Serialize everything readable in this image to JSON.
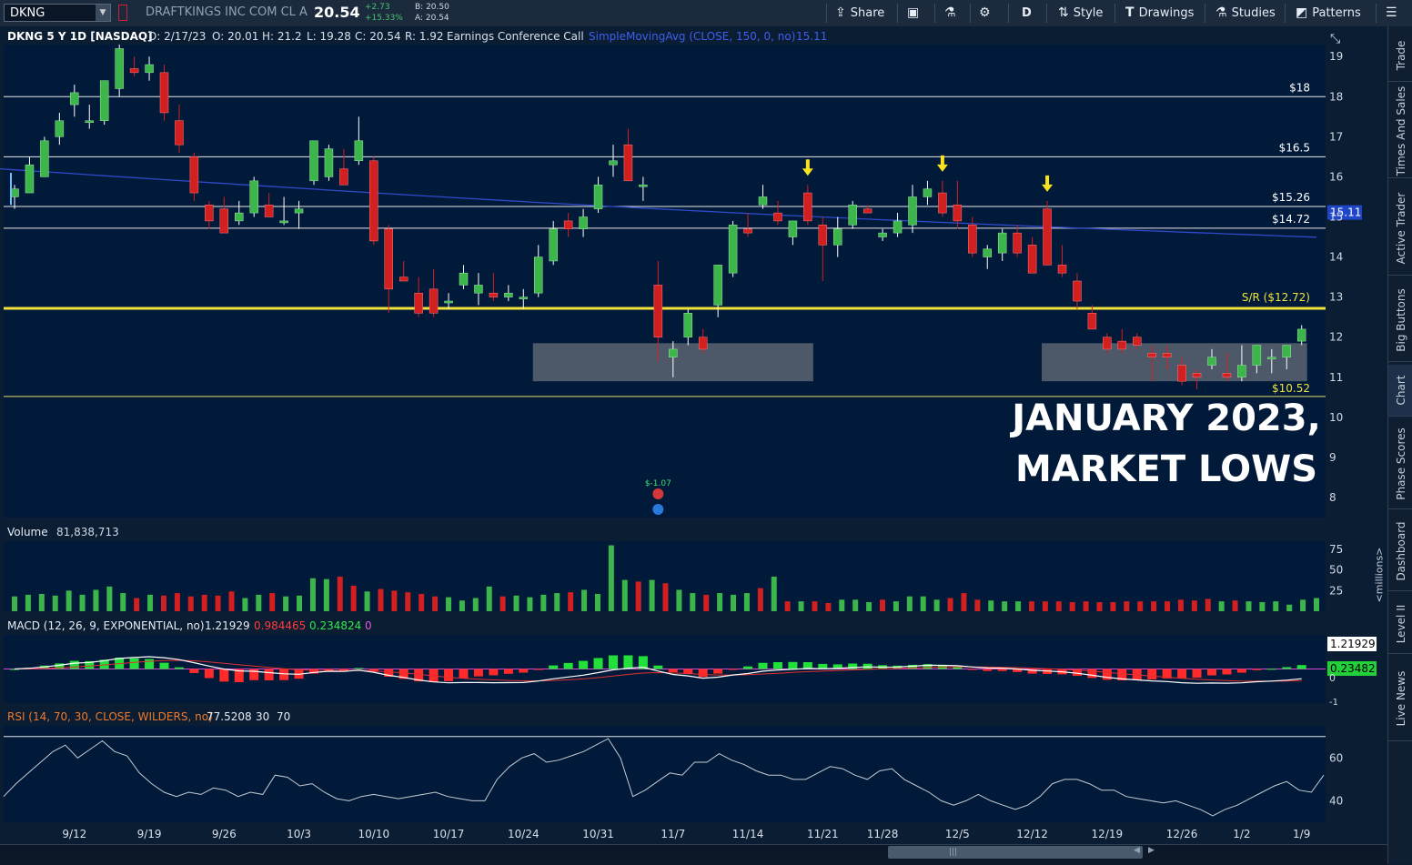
{
  "toolbar": {
    "symbol": "DKNG",
    "company": "DRAFTKINGS INC COM CL A",
    "last": "20.54",
    "change": "+2.73",
    "change_pct": "+15.33%",
    "bid": "B: 20.50",
    "ask": "A: 20.54",
    "share": "Share",
    "aggregation": "D",
    "style": "Style",
    "drawings": "Drawings",
    "studies": "Studies",
    "patterns": "Patterns"
  },
  "side_tabs": [
    "Trade",
    "Times And Sales",
    "Active Trader",
    "Big Buttons",
    "Chart",
    "Phase Scores",
    "Dashboard",
    "Level II",
    "Live News"
  ],
  "millions_label": "<millions>",
  "colors": {
    "up": "#3cb64a",
    "down": "#d21f1f",
    "sma": "#3049c9",
    "sr": "#f2e23a",
    "level": "#e8e8e8",
    "zone": "#5b6571",
    "bg": "#011a3a"
  },
  "chart_data": {
    "type": "candlestick",
    "header": {
      "title": "DKNG 5 Y 1D [NASDAQ]",
      "date": "D: 2/17/23",
      "open": "O: 20.01",
      "high": "H: 21.2",
      "low": "L: 19.28",
      "close": "C: 20.54",
      "range": "R: 1.92",
      "event": "Earnings Conference Call",
      "study": "SimpleMovingAvg (CLOSE, 150, 0, no)",
      "study_value": "15.11"
    },
    "annotation": [
      "JANUARY 2023,",
      "MARKET LOWS"
    ],
    "earnings": {
      "label": "$-1.07",
      "x_index": 43
    },
    "sma_label": "15.11",
    "ylim": [
      7.5,
      19.3
    ],
    "y_ticks": [
      8,
      9,
      10,
      11,
      12,
      13,
      14,
      15,
      16,
      17,
      18,
      19
    ],
    "x_ticks": [
      {
        "label": "9/12",
        "i": 4
      },
      {
        "label": "9/19",
        "i": 9
      },
      {
        "label": "9/26",
        "i": 14
      },
      {
        "label": "10/3",
        "i": 19
      },
      {
        "label": "10/10",
        "i": 24
      },
      {
        "label": "10/17",
        "i": 29
      },
      {
        "label": "10/24",
        "i": 34
      },
      {
        "label": "10/31",
        "i": 39
      },
      {
        "label": "11/7",
        "i": 44
      },
      {
        "label": "11/14",
        "i": 49
      },
      {
        "label": "11/21",
        "i": 54
      },
      {
        "label": "11/28",
        "i": 58
      },
      {
        "label": "12/5",
        "i": 63
      },
      {
        "label": "12/12",
        "i": 68
      },
      {
        "label": "12/19",
        "i": 73
      },
      {
        "label": "12/26",
        "i": 78
      },
      {
        "label": "1/2",
        "i": 82
      },
      {
        "label": "1/9",
        "i": 86
      }
    ],
    "levels": [
      {
        "label": "$18",
        "value": 18
      },
      {
        "label": "$16.5",
        "value": 16.5
      },
      {
        "label": "$15.26",
        "value": 15.26
      },
      {
        "label": "$14.72",
        "value": 14.72
      },
      {
        "label": "$10.52",
        "value": 10.52
      }
    ],
    "support_resistance": {
      "label": "S/R ($12.72)",
      "value": 12.72
    },
    "zones": [
      {
        "i_start": 35,
        "i_end": 53,
        "low": 10.9,
        "high": 11.85
      },
      {
        "i_start": 69,
        "i_end": 86,
        "low": 10.9,
        "high": 11.85
      }
    ],
    "arrows": [
      53,
      62,
      69
    ],
    "ohlc": [
      [
        15.5,
        15.8,
        15.2,
        15.7
      ],
      [
        15.6,
        16.5,
        15.6,
        16.3
      ],
      [
        16.0,
        17.0,
        16.0,
        16.9
      ],
      [
        17.0,
        17.6,
        16.8,
        17.4
      ],
      [
        17.8,
        18.3,
        17.5,
        18.1
      ],
      [
        17.4,
        17.8,
        17.2,
        17.4
      ],
      [
        17.4,
        18.4,
        17.3,
        18.4
      ],
      [
        18.2,
        19.3,
        18.0,
        19.2
      ],
      [
        18.7,
        19.0,
        18.5,
        18.6
      ],
      [
        18.6,
        19.0,
        18.4,
        18.8
      ],
      [
        18.6,
        18.8,
        17.4,
        17.6
      ],
      [
        17.4,
        17.8,
        16.6,
        16.8
      ],
      [
        16.5,
        16.6,
        15.4,
        15.6
      ],
      [
        15.3,
        15.4,
        14.7,
        14.9
      ],
      [
        15.2,
        15.5,
        14.6,
        14.6
      ],
      [
        14.9,
        15.4,
        14.8,
        15.1
      ],
      [
        15.1,
        16.0,
        15.0,
        15.9
      ],
      [
        15.3,
        15.6,
        15.0,
        15.0
      ],
      [
        14.9,
        15.5,
        14.8,
        14.9
      ],
      [
        15.1,
        15.4,
        14.7,
        15.2
      ],
      [
        15.9,
        16.8,
        15.8,
        16.9
      ],
      [
        16.0,
        16.8,
        15.9,
        16.7
      ],
      [
        16.2,
        16.7,
        15.9,
        15.8
      ],
      [
        16.4,
        17.5,
        16.3,
        16.9
      ],
      [
        16.4,
        16.5,
        14.3,
        14.4
      ],
      [
        14.7,
        14.8,
        12.6,
        13.2
      ],
      [
        13.5,
        13.9,
        13.4,
        13.4
      ],
      [
        13.1,
        13.5,
        12.5,
        12.6
      ],
      [
        13.2,
        13.7,
        12.5,
        12.6
      ],
      [
        12.9,
        13.1,
        12.7,
        12.9
      ],
      [
        13.3,
        13.8,
        13.2,
        13.6
      ],
      [
        13.1,
        13.6,
        12.8,
        13.3
      ],
      [
        13.1,
        13.6,
        12.9,
        13.0
      ],
      [
        13.0,
        13.3,
        12.9,
        13.1
      ],
      [
        13.0,
        13.2,
        12.7,
        13.0
      ],
      [
        13.1,
        14.3,
        13.0,
        14.0
      ],
      [
        13.9,
        14.9,
        13.8,
        14.7
      ],
      [
        14.9,
        15.1,
        14.5,
        14.7
      ],
      [
        14.7,
        15.2,
        14.5,
        15.0
      ],
      [
        15.2,
        16.0,
        15.1,
        15.8
      ],
      [
        16.3,
        16.8,
        16.0,
        16.4
      ],
      [
        16.8,
        17.2,
        15.9,
        15.9
      ],
      [
        15.8,
        16.0,
        15.4,
        15.8
      ],
      [
        13.3,
        13.9,
        11.4,
        12.0
      ],
      [
        11.5,
        11.9,
        11.0,
        11.7
      ],
      [
        12.0,
        12.7,
        11.8,
        12.6
      ],
      [
        12.0,
        12.2,
        11.6,
        11.7
      ],
      [
        12.8,
        13.8,
        12.5,
        13.8
      ],
      [
        13.6,
        14.9,
        13.5,
        14.8
      ],
      [
        14.7,
        15.1,
        14.5,
        14.6
      ],
      [
        15.3,
        15.8,
        15.2,
        15.5
      ],
      [
        15.1,
        15.4,
        14.8,
        14.9
      ],
      [
        14.5,
        14.8,
        14.3,
        14.9
      ],
      [
        15.6,
        15.8,
        14.8,
        14.9
      ],
      [
        14.8,
        15.0,
        13.4,
        14.3
      ],
      [
        14.3,
        15.0,
        14.0,
        14.7
      ],
      [
        14.8,
        15.4,
        14.7,
        15.3
      ],
      [
        15.2,
        15.3,
        15.1,
        15.1
      ],
      [
        14.5,
        14.7,
        14.4,
        14.6
      ],
      [
        14.6,
        15.1,
        14.5,
        14.9
      ],
      [
        14.8,
        15.8,
        14.6,
        15.5
      ],
      [
        15.5,
        15.9,
        15.3,
        15.7
      ],
      [
        15.6,
        15.9,
        15.0,
        15.1
      ],
      [
        15.3,
        15.9,
        14.7,
        14.9
      ],
      [
        14.8,
        15.0,
        14.0,
        14.1
      ],
      [
        14.0,
        14.3,
        13.7,
        14.2
      ],
      [
        14.1,
        14.7,
        13.9,
        14.6
      ],
      [
        14.6,
        14.8,
        14.0,
        14.1
      ],
      [
        14.3,
        14.5,
        13.6,
        13.6
      ],
      [
        15.2,
        15.4,
        13.8,
        13.8
      ],
      [
        13.8,
        14.3,
        13.5,
        13.6
      ],
      [
        13.4,
        13.6,
        12.7,
        12.9
      ],
      [
        12.6,
        12.8,
        12.2,
        12.2
      ],
      [
        12.0,
        12.1,
        11.6,
        11.7
      ],
      [
        11.9,
        12.2,
        11.6,
        11.7
      ],
      [
        12.0,
        12.1,
        11.7,
        11.8
      ],
      [
        11.6,
        11.8,
        10.9,
        11.5
      ],
      [
        11.6,
        11.8,
        11.2,
        11.5
      ],
      [
        11.3,
        11.5,
        10.8,
        10.9
      ],
      [
        11.1,
        11.2,
        10.7,
        11.0
      ],
      [
        11.3,
        11.7,
        11.2,
        11.5
      ],
      [
        11.1,
        11.6,
        10.9,
        11.0
      ],
      [
        11.0,
        11.8,
        10.9,
        11.3
      ],
      [
        11.3,
        11.8,
        11.1,
        11.8
      ],
      [
        11.5,
        11.7,
        11.1,
        11.5
      ],
      [
        11.5,
        11.8,
        11.2,
        11.8
      ],
      [
        11.9,
        12.3,
        11.8,
        12.2
      ]
    ],
    "volume": {
      "title": "Volume",
      "value": "81,838,713",
      "ylim": [
        0,
        85
      ],
      "y_ticks": [
        25,
        50,
        75
      ],
      "values": [
        18,
        20,
        21,
        19,
        25,
        20,
        26,
        30,
        22,
        16,
        20,
        19,
        22,
        18,
        20,
        19,
        24,
        16,
        20,
        22,
        18,
        19,
        40,
        39,
        42,
        31,
        24,
        27,
        25,
        23,
        21,
        18,
        17,
        13,
        16,
        30,
        18,
        19,
        17,
        20,
        22,
        23,
        26,
        21,
        80,
        38,
        36,
        38,
        34,
        26,
        22,
        20,
        22,
        20,
        22,
        28,
        42,
        12,
        12,
        12,
        10,
        14,
        14,
        11,
        14,
        12,
        18,
        18,
        14,
        16,
        22,
        14,
        13,
        12,
        12,
        12,
        12,
        12,
        11,
        12,
        11,
        11,
        12,
        12,
        12,
        12,
        14,
        13,
        15,
        12,
        13,
        12,
        11,
        12,
        8,
        14,
        16
      ]
    },
    "macd": {
      "title": "MACD (12, 26, 9, EXPONENTIAL, no)",
      "value": "1.21929",
      "avg": "0.984465",
      "diff": "0.234824",
      "zero": "0",
      "axis_value": "1.21929",
      "axis_diff": "0.23482",
      "axis_zero": "0",
      "axis_neg": "-1",
      "ylim": [
        -1.2,
        1.2
      ]
    },
    "rsi": {
      "title": "RSI (14, 70, 30, CLOSE, WILDERS, no)",
      "value": "77.5208",
      "lower": "30",
      "upper": "70",
      "ylim": [
        30,
        75
      ],
      "y_ticks": [
        40,
        60
      ],
      "values": [
        42,
        48,
        53,
        58,
        63,
        66,
        60,
        64,
        68,
        63,
        61,
        53,
        48,
        44,
        42,
        44,
        43,
        46,
        45,
        42,
        44,
        43,
        52,
        51,
        47,
        48,
        44,
        41,
        40,
        42,
        43,
        42,
        41,
        42,
        43,
        44,
        42,
        41,
        40,
        40,
        50,
        56,
        60,
        62,
        58,
        59,
        61,
        63,
        66,
        69,
        60,
        42,
        45,
        49,
        53,
        52,
        58,
        58,
        62,
        59,
        57,
        54,
        52,
        52,
        50,
        50,
        53,
        56,
        55,
        52,
        50,
        54,
        55,
        50,
        47,
        44,
        40,
        38,
        40,
        43,
        40,
        38,
        36,
        38,
        42,
        48,
        50,
        50,
        48,
        45,
        45,
        42,
        41,
        40,
        39,
        40,
        38,
        36,
        33,
        36,
        38,
        41,
        44,
        47,
        49,
        45,
        44,
        52
      ]
    }
  }
}
